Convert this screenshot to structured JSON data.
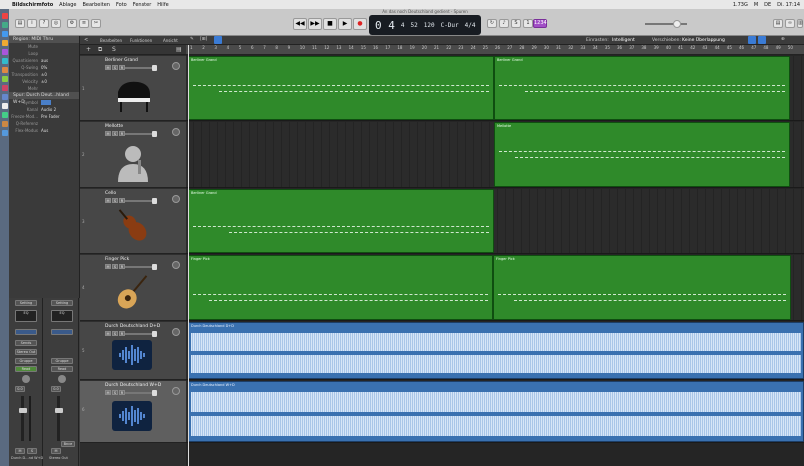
{
  "menubar": {
    "apple": "",
    "app": "Bildschirmfoto",
    "items": [
      "Ablage",
      "Bearbeiten",
      "Foto",
      "Fenster",
      "Hilfe"
    ],
    "status": [
      "1.73G",
      "M",
      "DE"
    ],
    "clock": "Di. 17:14"
  },
  "window_title": "An das noch Deutschland gedient - Spuren",
  "lcd": {
    "bar": "0 4",
    "beat": "4",
    "tempo": "52",
    "bpm": "120",
    "key": "C-Dur",
    "signature": "4/4"
  },
  "toolbar": {
    "cpu_label": "1234"
  },
  "inspector": {
    "region_header": "Region: MIDI Thru",
    "rows": [
      {
        "k": "Mute",
        "v": ""
      },
      {
        "k": "Loop",
        "v": ""
      },
      {
        "k": "Quantisieren",
        "v": "aus"
      },
      {
        "k": "Q-Swing",
        "v": "0%"
      },
      {
        "k": "Transposition",
        "v": "±0"
      },
      {
        "k": "Velocity",
        "v": "±0"
      },
      {
        "k": "Mehr",
        "v": ""
      }
    ],
    "track_header": "Spur: Durch Deut...hland W+D",
    "track_rows": [
      {
        "k": "Symbol",
        "v": ""
      },
      {
        "k": "Kanal",
        "v": "Audio 2"
      },
      {
        "k": "Freeze-Mod...",
        "v": "Pre Fader"
      },
      {
        "k": "Q-Referenz",
        "v": ""
      },
      {
        "k": "Flex-Modus",
        "v": "Aus"
      }
    ]
  },
  "strips": {
    "left": {
      "setting": "Setting",
      "eq": "EQ",
      "sends": "Sends",
      "output": "Stereo Out",
      "group": "Gruppe",
      "mode": "Read",
      "volume": "0.0",
      "name": "Durch D...nd W+D"
    },
    "right": {
      "setting": "Setting",
      "eq": "EQ",
      "sends": "",
      "output": "",
      "group": "Gruppe",
      "mode": "Read",
      "volume": "0.0",
      "name": "Stereo Out",
      "bounce": "Bnce"
    }
  },
  "tracklist_header": {
    "edit": "Bearbeiten",
    "functions": "Funktionen",
    "view": "Ansicht",
    "snap": "Einrasten:",
    "snap_value": "Intelligent",
    "drag": "Verschieben:",
    "drag_value": "Keine Überlappung"
  },
  "tracks": [
    {
      "num": "1",
      "name": "Berliner Grand",
      "thumb": "piano-icon"
    },
    {
      "num": "2",
      "name": "Mellotte",
      "thumb": "person-icon"
    },
    {
      "num": "3",
      "name": "Cello",
      "thumb": "violin-icon"
    },
    {
      "num": "4",
      "name": "Finger Pick",
      "thumb": "guitar-icon"
    },
    {
      "num": "5",
      "name": "Durch Deutschland D+D",
      "thumb": "waveform-icon"
    },
    {
      "num": "6",
      "name": "Durch Deutschland W+D",
      "thumb": "waveform-icon"
    }
  ],
  "ruler_ticks": [
    "1",
    "2",
    "3",
    "4",
    "5",
    "6",
    "7",
    "8",
    "9",
    "10",
    "11",
    "12",
    "13",
    "14",
    "15",
    "16",
    "17",
    "18",
    "19",
    "20",
    "21",
    "22",
    "23",
    "24",
    "25",
    "26",
    "27",
    "28",
    "29",
    "30",
    "31",
    "32",
    "33",
    "34",
    "35",
    "36",
    "37",
    "38",
    "39",
    "40",
    "41",
    "42",
    "43",
    "44",
    "45",
    "46",
    "47",
    "48",
    "49",
    "50"
  ],
  "regions": [
    {
      "lane": 0,
      "label": "Berliner Grand",
      "kind": "midi"
    },
    {
      "lane": 0,
      "label": "Berliner Grand",
      "kind": "midi"
    },
    {
      "lane": 1,
      "label": "Mellotte",
      "kind": "midi"
    },
    {
      "lane": 2,
      "label": "Berliner Grand",
      "kind": "midi"
    },
    {
      "lane": 3,
      "label": "Finger Pick",
      "kind": "midi"
    },
    {
      "lane": 3,
      "label": "Finger Pick",
      "kind": "midi"
    },
    {
      "lane": 4,
      "label": "Durch Deutschland D+D",
      "kind": "audio"
    },
    {
      "lane": 5,
      "label": "Durch Deutschland W+D",
      "kind": "audio"
    }
  ],
  "colors": {
    "midi": "#2f8a2a",
    "audio": "#3a71b0"
  }
}
